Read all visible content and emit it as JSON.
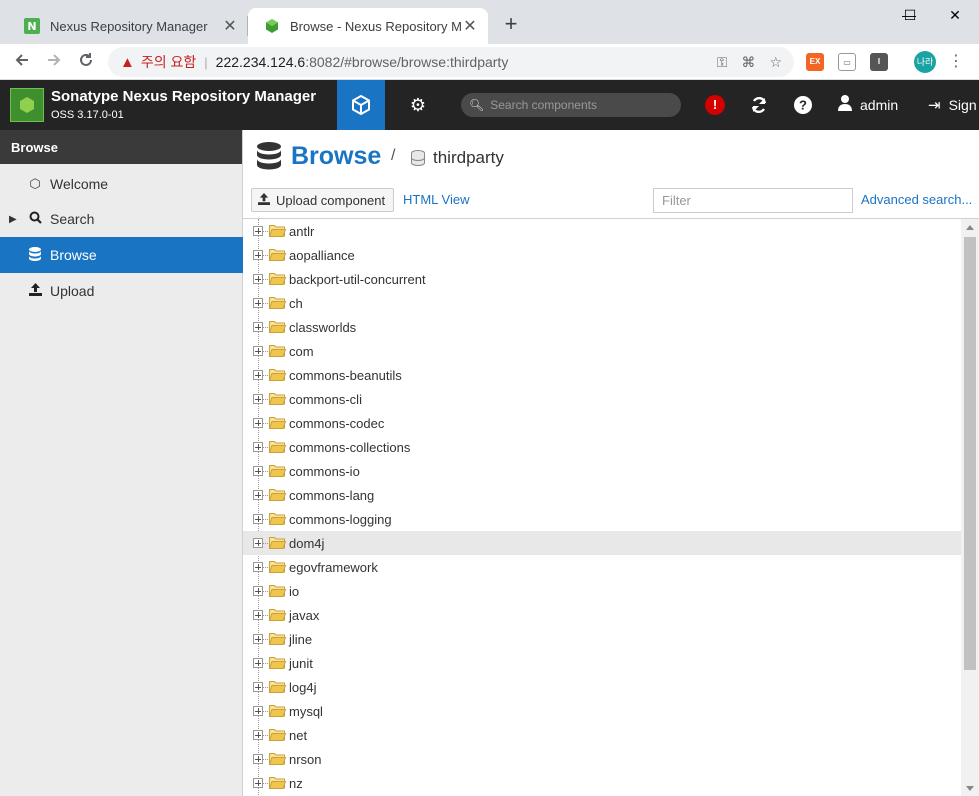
{
  "browser": {
    "tabs": [
      {
        "title": "Nexus Repository Manager",
        "close": "✕"
      },
      {
        "title": "Browse - Nexus Repository Manager",
        "close": "✕"
      }
    ],
    "new_tab": "+",
    "window_controls": {
      "minimize": "—",
      "maximize": "☐",
      "close": "✕"
    },
    "security_warning": "주의 요함",
    "url_host": "222.234.124.6",
    "url_rest": ":8082/#browse/browse:thirdparty",
    "profile_initials": "나라"
  },
  "app": {
    "title": "Sonatype Nexus Repository Manager",
    "version": "OSS 3.17.0-01",
    "search_placeholder": "Search components",
    "user": "admin",
    "signout": "Sign out"
  },
  "sidebar": {
    "header": "Browse",
    "items": [
      {
        "label": "Welcome",
        "icon": "hexagon-icon",
        "active": false
      },
      {
        "label": "Search",
        "icon": "search-icon",
        "active": false
      },
      {
        "label": "Browse",
        "icon": "database-icon",
        "active": true
      },
      {
        "label": "Upload",
        "icon": "upload-icon",
        "active": false
      }
    ]
  },
  "main": {
    "title": "Browse",
    "breadcrumb_sep": "/",
    "repository": "thirdparty",
    "upload_button": "Upload component",
    "html_view": "HTML View",
    "filter_placeholder": "Filter",
    "advanced_search": "Advanced search..."
  },
  "tree": {
    "selected": "dom4j",
    "items": [
      "antlr",
      "aopalliance",
      "backport-util-concurrent",
      "ch",
      "classworlds",
      "com",
      "commons-beanutils",
      "commons-cli",
      "commons-codec",
      "commons-collections",
      "commons-io",
      "commons-lang",
      "commons-logging",
      "dom4j",
      "egovframework",
      "io",
      "javax",
      "jline",
      "junit",
      "log4j",
      "mysql",
      "net",
      "nrson",
      "nz"
    ]
  },
  "colors": {
    "accent": "#1a74c4",
    "header_bg": "#242424",
    "sidebar_bg": "#ececec",
    "folder": "#f3c44d",
    "alert": "#d40000"
  }
}
